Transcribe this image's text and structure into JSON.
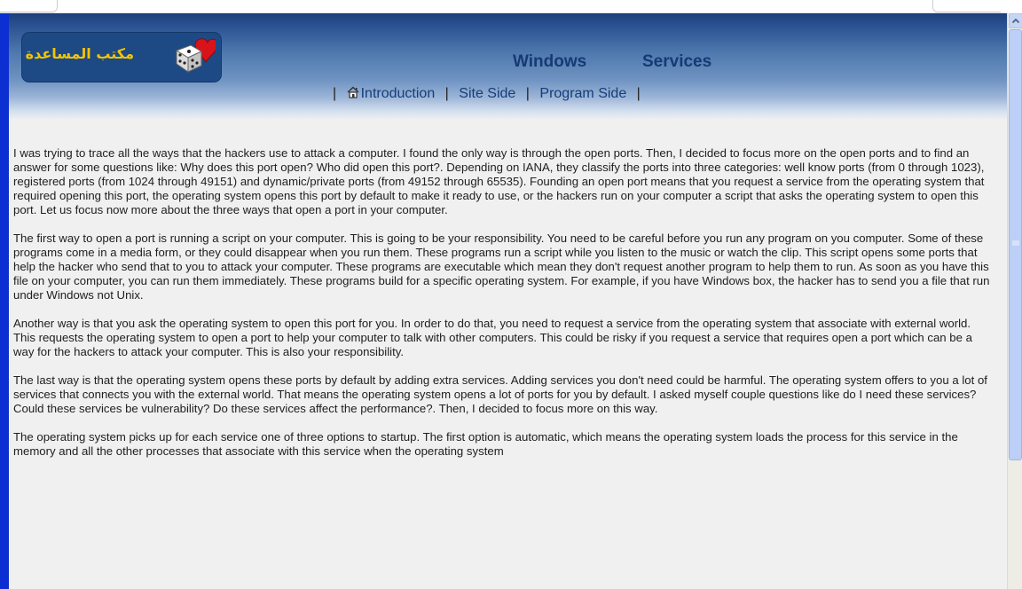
{
  "logo": {
    "text": "مكتب المساعدة",
    "text_color": "#f4c400"
  },
  "header": {
    "title_left": "Windows",
    "title_right": "Services",
    "nav": [
      {
        "label": "Introduction",
        "icon": "home-icon"
      },
      {
        "label": "Site Side"
      },
      {
        "label": "Program Side"
      }
    ],
    "separator": "|"
  },
  "content": {
    "paragraphs": [
      "I was trying to trace all the ways that the hackers use to attack a computer. I found the only way is through the open ports. Then, I decided to focus more on the open ports and to find an answer for some questions like: Why does this port open? Who did open this port?. Depending on IANA, they classify the ports into three categories: well know ports (from 0 through 1023), registered ports (from 1024 through 49151) and dynamic/private ports (from 49152 through 65535). Founding an open port means that you request a service from the operating system that required opening this port, the operating system opens this port by default to make it ready to use, or the hackers run on your computer a script that asks the operating system to open this port. Let us focus now more about the three ways that open a port in your computer.",
      "The first way to open a port is running a script on your computer. This is going to be your responsibility. You need to be careful before you run any program on you computer. Some of these programs come in a media form, or they could disappear when you run them. These programs run a script while you listen to the music or watch the clip. This script opens some ports that help the hacker who send that to you to attack your computer. These programs are executable which mean they don't request another program to help them to run. As soon as you have this file on your computer, you can run them immediately. These programs build for a specific operating system. For example, if you have Windows box, the hacker has to send you a file that run under Windows not Unix.",
      "Another way is that you ask the operating system to open this port for you. In order to do that, you need to request a service from the operating system that associate with external world. This requests the operating system to open a port to help your computer to talk with other computers. This could be risky if you request a service that requires open a port which can be a way for the hackers to attack your computer. This is also your responsibility.",
      "The last way is that the operating system opens these ports by default by adding extra services. Adding services you don't need could be harmful. The operating system offers to you a lot of services that connects you with the external world. That means the operating system opens a lot of ports for you by default. I asked myself couple questions like do I need these services? Could these services be vulnerability? Do these services affect the performance?. Then, I decided to focus more on this way.",
      "The operating system picks up for each service one of three options to startup. The first option is automatic, which means the operating system loads the process for this service in the memory and all the other processes that associate with this service when the operating system"
    ]
  },
  "colors": {
    "accent_bar": "#0b2fd0",
    "header_dark": "#1c3f7a",
    "nav_link": "#153d7a",
    "page_bg": "#f0f0f1"
  },
  "scrollbar": {
    "up_icon": "chevron-up-icon"
  }
}
